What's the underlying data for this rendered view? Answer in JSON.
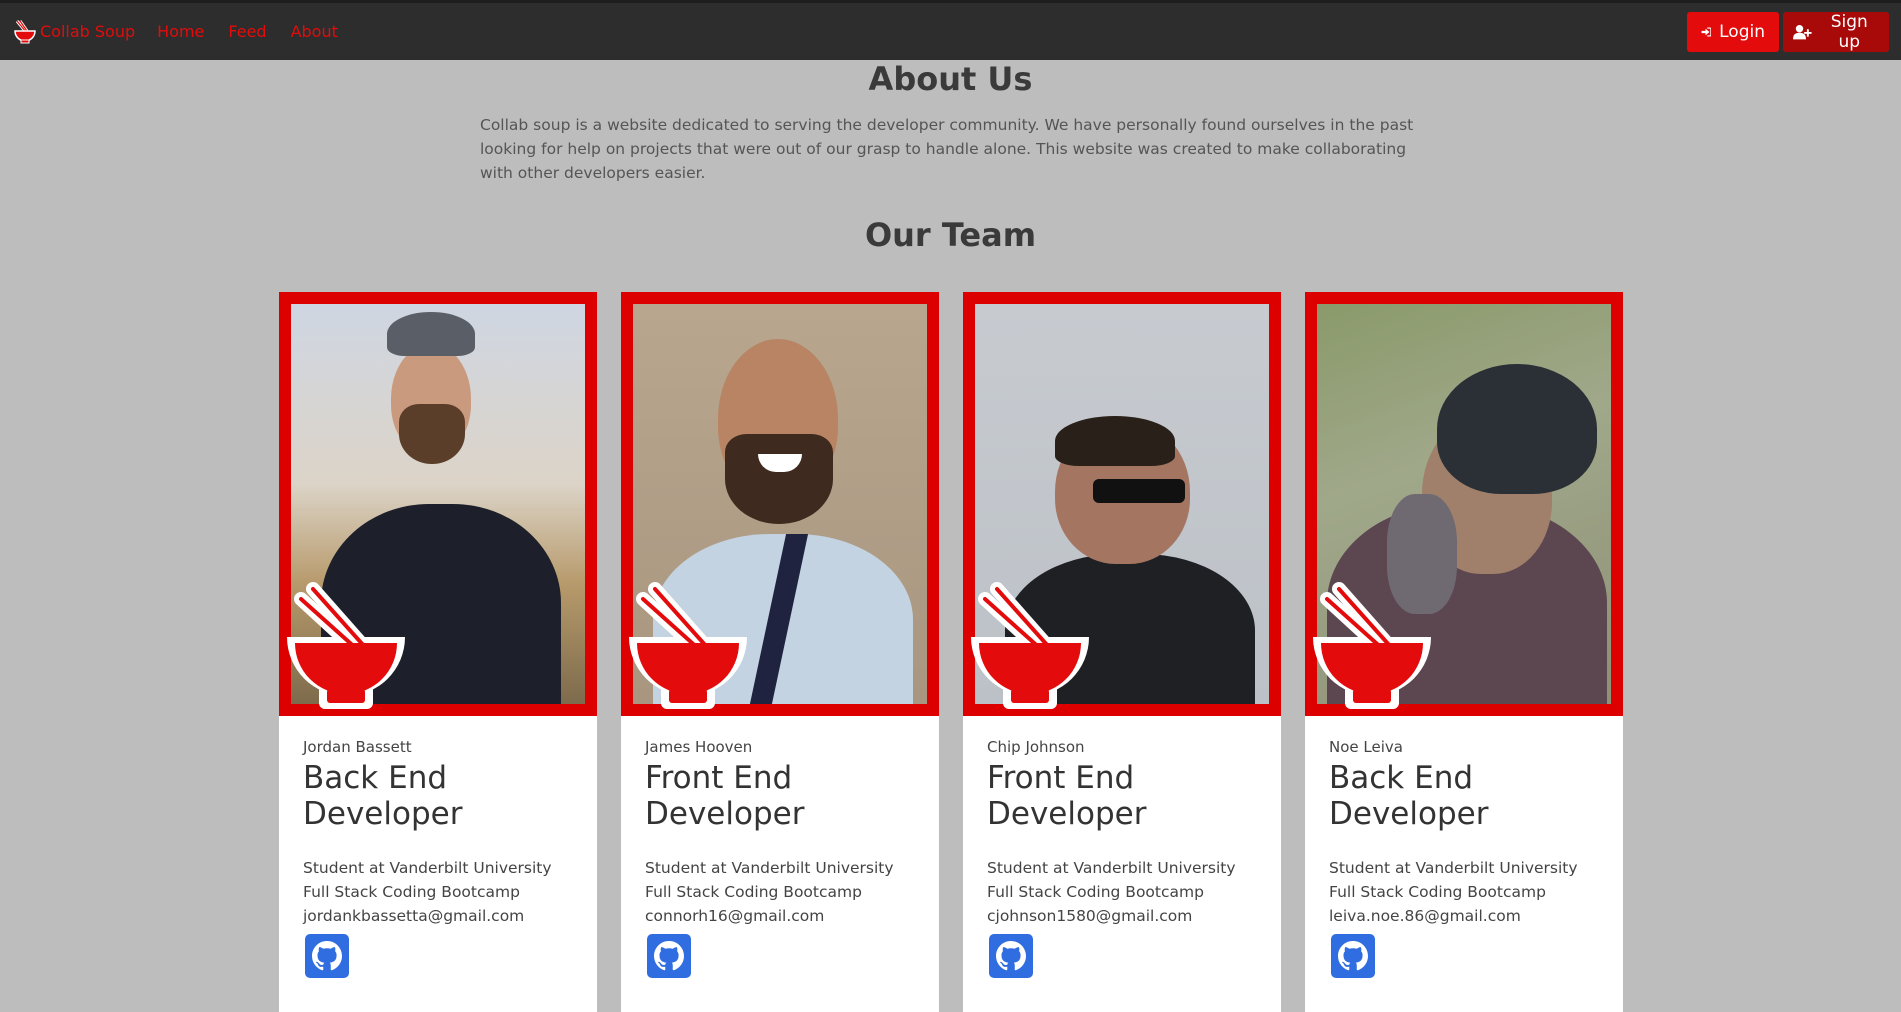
{
  "nav": {
    "brand": "Collab Soup",
    "links": [
      "Home",
      "Feed",
      "About"
    ],
    "login_label": "Login",
    "signup_label": "Sign up"
  },
  "about": {
    "title": "About Us",
    "text": "Collab soup is a website dedicated to serving the developer community. We have personally found ourselves in the past looking for help on projects that were out of our grasp to handle alone. This website was created to make collaborating with other developers easier."
  },
  "team": {
    "title": "Our Team",
    "members": [
      {
        "name": "Jordan Bassett",
        "role": "Back End Developer",
        "description": "Student at Vanderbilt University Full Stack Coding Bootcamp",
        "email": "jordankbassetta@gmail.com"
      },
      {
        "name": "James Hooven",
        "role": "Front End Developer",
        "description": "Student at Vanderbilt University Full Stack Coding Bootcamp",
        "email": "connorh16@gmail.com"
      },
      {
        "name": "Chip Johnson",
        "role": "Front End Developer",
        "description": "Student at Vanderbilt University Full Stack Coding Bootcamp",
        "email": "cjohnson1580@gmail.com"
      },
      {
        "name": "Noe Leiva",
        "role": "Back End Developer",
        "description": "Student at Vanderbilt University Full Stack Coding Bootcamp",
        "email": "leiva.noe.86@gmail.com"
      }
    ]
  },
  "colors": {
    "accent": "#e30b0b",
    "navbar": "#2d2d2d",
    "page_background": "#bdbdbd",
    "github_button": "#2f6de0"
  },
  "icons": [
    "soup-bowl-icon",
    "login-icon",
    "add-user-icon",
    "github-icon"
  ]
}
